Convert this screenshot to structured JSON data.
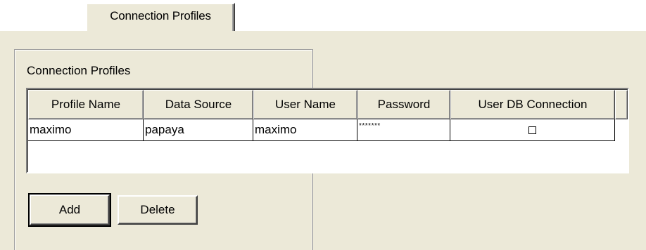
{
  "tab": {
    "label": "Connection Profiles"
  },
  "panel": {
    "title": "Connection Profiles"
  },
  "grid": {
    "columns": [
      "Profile Name",
      "Data Source",
      "User Name",
      "Password",
      "User DB Connection"
    ],
    "rows": [
      {
        "profile_name": "maximo",
        "data_source": "papaya",
        "user_name": "maximo",
        "password": "*******",
        "user_db_connection": false
      }
    ]
  },
  "buttons": {
    "add": "Add",
    "delete": "Delete"
  }
}
